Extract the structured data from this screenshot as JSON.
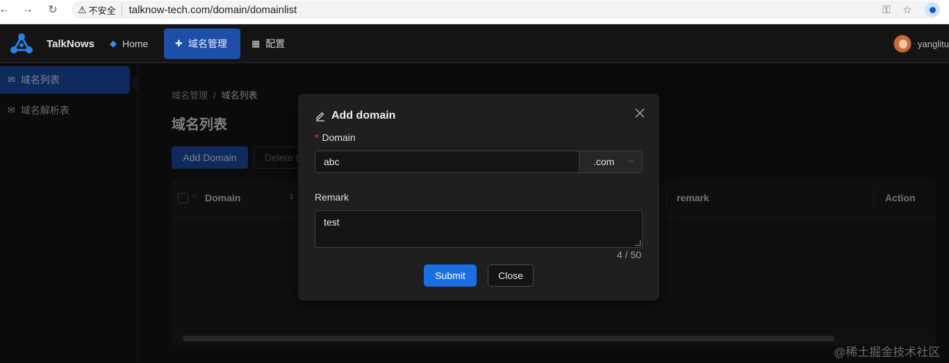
{
  "browser": {
    "security_label": "不安全",
    "url": "talknow-tech.com/domain/domainlist"
  },
  "header": {
    "app_name": "TalkNows",
    "menu": [
      {
        "label": "Home",
        "icon": "diamond-icon"
      },
      {
        "label": "域名管理",
        "icon": "puzzle-icon",
        "active": true
      },
      {
        "label": "配置",
        "icon": "grid-icon"
      }
    ],
    "username": "yanglitu"
  },
  "sidebar": {
    "items": [
      {
        "label": "域名列表",
        "icon": "mail-icon",
        "active": true
      },
      {
        "label": "域名解析表",
        "icon": "mail-icon"
      }
    ]
  },
  "main": {
    "breadcrumb": [
      "域名管理",
      "/",
      "域名列表"
    ],
    "title": "域名列表",
    "add_button": "Add Domain",
    "delete_button": "Delete D",
    "table_headers": [
      "Domain",
      "remark",
      "Action"
    ]
  },
  "modal": {
    "title": "Add domain",
    "domain_label": "Domain",
    "domain_value": "abc",
    "suffix_value": ".com",
    "remark_label": "Remark",
    "remark_value": "test",
    "counter": "4 / 50",
    "submit_label": "Submit",
    "close_label": "Close"
  },
  "watermark": "@稀土掘金技术社区",
  "colors": {
    "accent": "#1a6fe0",
    "active_menu": "#1d4eaa",
    "required": "#e5484d"
  }
}
